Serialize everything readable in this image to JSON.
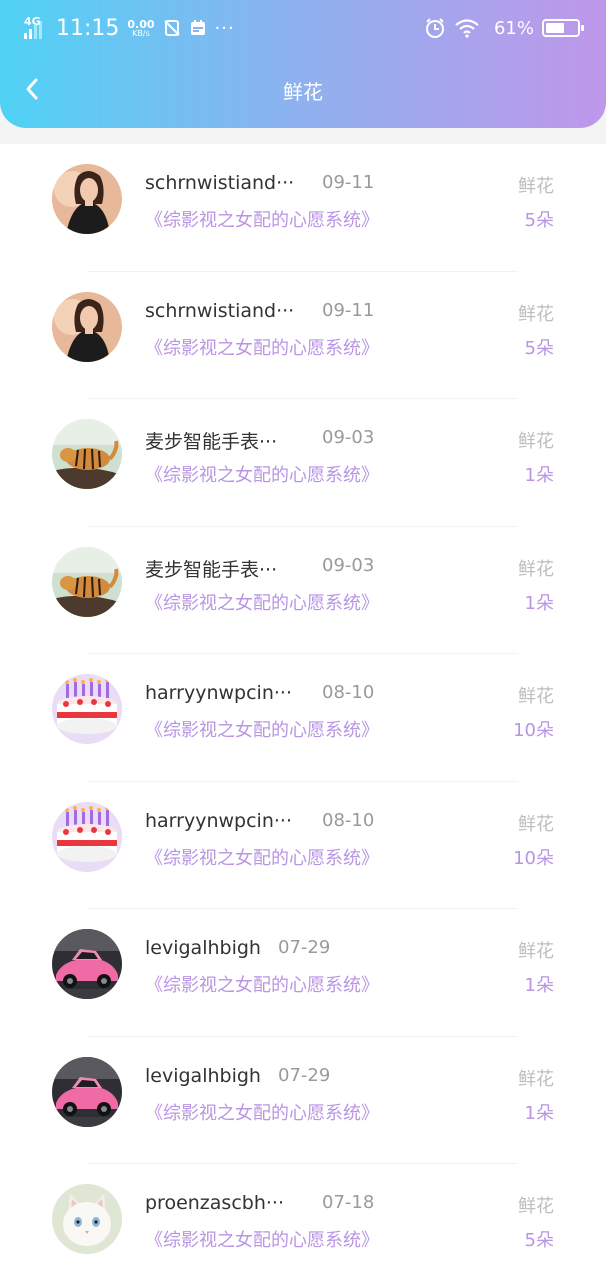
{
  "status_bar": {
    "network": "4G",
    "time": "11:15",
    "speed_value": "0.00",
    "speed_unit": "KB/s",
    "dots": "···",
    "battery_percent": "61%",
    "battery_level": 0.61
  },
  "header": {
    "title": "鲜花"
  },
  "records": [
    {
      "name": "schrnwistiand···",
      "date": "09-11",
      "book": "《综影视之女配的心愿系统》",
      "gift_type": "鲜花",
      "gift_count": "5朵",
      "avatar_icon": "woman-avatar"
    },
    {
      "name": "schrnwistiand···",
      "date": "09-11",
      "book": "《综影视之女配的心愿系统》",
      "gift_type": "鲜花",
      "gift_count": "5朵",
      "avatar_icon": "woman-avatar"
    },
    {
      "name": "麦步智能手表···",
      "date": "09-03",
      "book": "《综影视之女配的心愿系统》",
      "gift_type": "鲜花",
      "gift_count": "1朵",
      "avatar_icon": "tiger-avatar"
    },
    {
      "name": "麦步智能手表···",
      "date": "09-03",
      "book": "《综影视之女配的心愿系统》",
      "gift_type": "鲜花",
      "gift_count": "1朵",
      "avatar_icon": "tiger-avatar"
    },
    {
      "name": "harryynwpcin···",
      "date": "08-10",
      "book": "《综影视之女配的心愿系统》",
      "gift_type": "鲜花",
      "gift_count": "10朵",
      "avatar_icon": "cake-avatar"
    },
    {
      "name": "harryynwpcin···",
      "date": "08-10",
      "book": "《综影视之女配的心愿系统》",
      "gift_type": "鲜花",
      "gift_count": "10朵",
      "avatar_icon": "cake-avatar"
    },
    {
      "name": "levigalhbigh",
      "date": "07-29",
      "book": "《综影视之女配的心愿系统》",
      "gift_type": "鲜花",
      "gift_count": "1朵",
      "avatar_icon": "car-avatar"
    },
    {
      "name": "levigalhbigh",
      "date": "07-29",
      "book": "《综影视之女配的心愿系统》",
      "gift_type": "鲜花",
      "gift_count": "1朵",
      "avatar_icon": "car-avatar"
    },
    {
      "name": "proenzascbh···",
      "date": "07-18",
      "book": "《综影视之女配的心愿系统》",
      "gift_type": "鲜花",
      "gift_count": "5朵",
      "avatar_icon": "cat-avatar"
    }
  ]
}
